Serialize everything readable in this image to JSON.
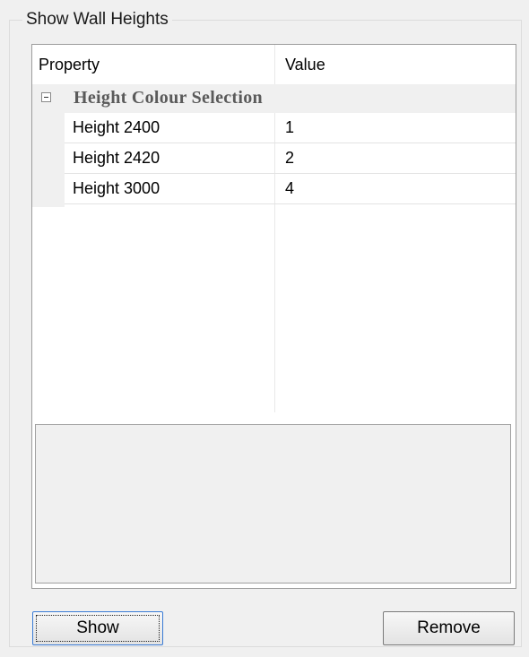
{
  "groupbox": {
    "title": "Show Wall Heights"
  },
  "grid": {
    "header_property": "Property",
    "header_value": "Value",
    "category": {
      "label": "Height Colour Selection",
      "expanded": true,
      "icon": "collapse-minus-icon"
    },
    "rows": [
      {
        "name": "Height 2400",
        "value": "1"
      },
      {
        "name": "Height 2420",
        "value": "2"
      },
      {
        "name": "Height 3000",
        "value": "4"
      }
    ]
  },
  "buttons": {
    "show_label": "Show",
    "remove_label": "Remove"
  }
}
